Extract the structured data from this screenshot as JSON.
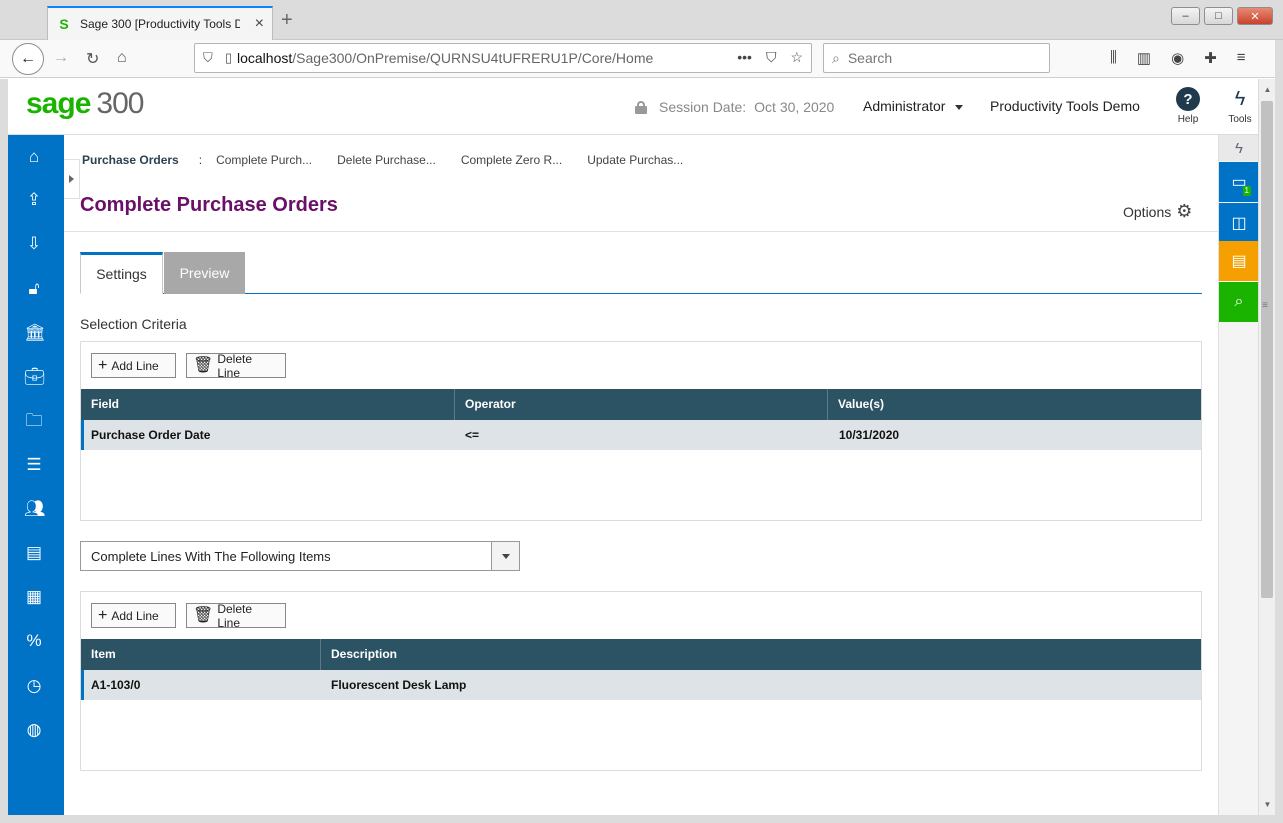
{
  "browser": {
    "tab_title": "Sage 300 [Productivity Tools De",
    "tab_favicon": "S",
    "new_tab": "+",
    "url_host": "localhost",
    "url_path": "/Sage300/OnPremise/QURNSU4tUFRERU1P/Core/Home",
    "search_placeholder": "Search",
    "url_dots": "•••"
  },
  "app": {
    "logo_brand": "sage",
    "logo_number": "300",
    "session_label": "Session Date:",
    "session_date": "Oct 30, 2020",
    "user": "Administrator",
    "company": "Productivity Tools Demo",
    "help_label": "Help",
    "tools_label": "Tools"
  },
  "breadcrumb": {
    "first": "Purchase Orders",
    "separator": ":",
    "items": [
      "Complete Purch...",
      "Delete Purchase...",
      "Complete Zero R...",
      "Update Purchas..."
    ]
  },
  "page": {
    "title": "Complete Purchase Orders",
    "options_label": "Options",
    "tabs": [
      "Settings",
      "Preview"
    ],
    "selection_label": "Selection Criteria"
  },
  "grid1": {
    "add_label": "Add Line",
    "delete_label": "Delete Line",
    "columns": [
      "Field",
      "Operator",
      "Value(s)"
    ],
    "rows": [
      {
        "field": "Purchase Order Date",
        "operator": "<=",
        "value": "10/31/2020"
      }
    ]
  },
  "dropdown": {
    "value": "Complete Lines With The Following Items"
  },
  "grid2": {
    "add_label": "Add Line",
    "delete_label": "Delete Line",
    "columns": [
      "Item",
      "Description"
    ],
    "rows": [
      {
        "item": "A1-103/0",
        "description": "Fluorescent Desk Lamp"
      }
    ]
  },
  "rightbar": {
    "badge_count": "1"
  },
  "colors": {
    "nav_blue": "#0073c6",
    "title_purple": "#6b1068",
    "grid_header": "#2c5364",
    "brand_green": "#1ab400",
    "orange": "#f5a000"
  }
}
